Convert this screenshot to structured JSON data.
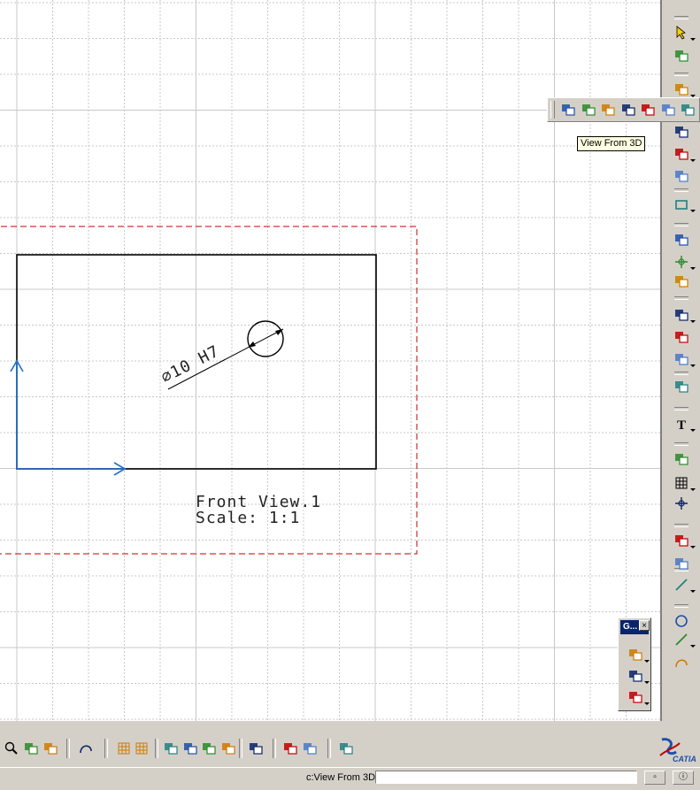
{
  "drawing": {
    "view_name": "Front View.1",
    "view_scale": "Scale:  1:1",
    "dimension_text": "∅10 H7"
  },
  "tooltip": {
    "text": "View From 3D"
  },
  "geometry_toolbar": {
    "title": "G...",
    "close": "×"
  },
  "status_bar": {
    "text": "c:View From 3D",
    "input_value": ""
  },
  "colors": {
    "grid": "#c8c8c8",
    "view_frame": "#c00000",
    "axis": "#1f6fd0",
    "title_bar": "#0a246a",
    "tooltip_bg": "#ffffe1"
  },
  "icons": {
    "right_toolbar": [
      "select-arrow-icon",
      "update-icon",
      "views-icon",
      "dimension-icon",
      "annotation-icon",
      "sheet-icon",
      "rectangle-icon",
      "pattern-icon",
      "positioning-icon",
      "dimension-chain-icon",
      "dimension-tolerance-icon",
      "dimension-angle-icon",
      "balloon-icon",
      "axis-icon",
      "text-icon",
      "roughness-icon",
      "table-icon",
      "point-icon",
      "trim-icon",
      "corner-icon",
      "line-icon",
      "circle-icon",
      "spline-icon",
      "arc-icon"
    ],
    "floating_toolbar": [
      "front-view-icon",
      "projection-view-icon",
      "aux-view-icon",
      "isometric-view-icon",
      "advanced-front-view-icon",
      "view-from-3d-icon",
      "unfolded-view-icon"
    ],
    "bottom_toolbar": [
      "zoom-icon",
      "fit-icon",
      "pan-icon",
      "rotate-icon",
      "grid-icon",
      "snap-icon",
      "analysis-icon",
      "view-filter-icon",
      "generate-icon",
      "dimension-update-icon",
      "frame-icon",
      "move-icon",
      "catalog-icon",
      "layer-icon"
    ]
  }
}
